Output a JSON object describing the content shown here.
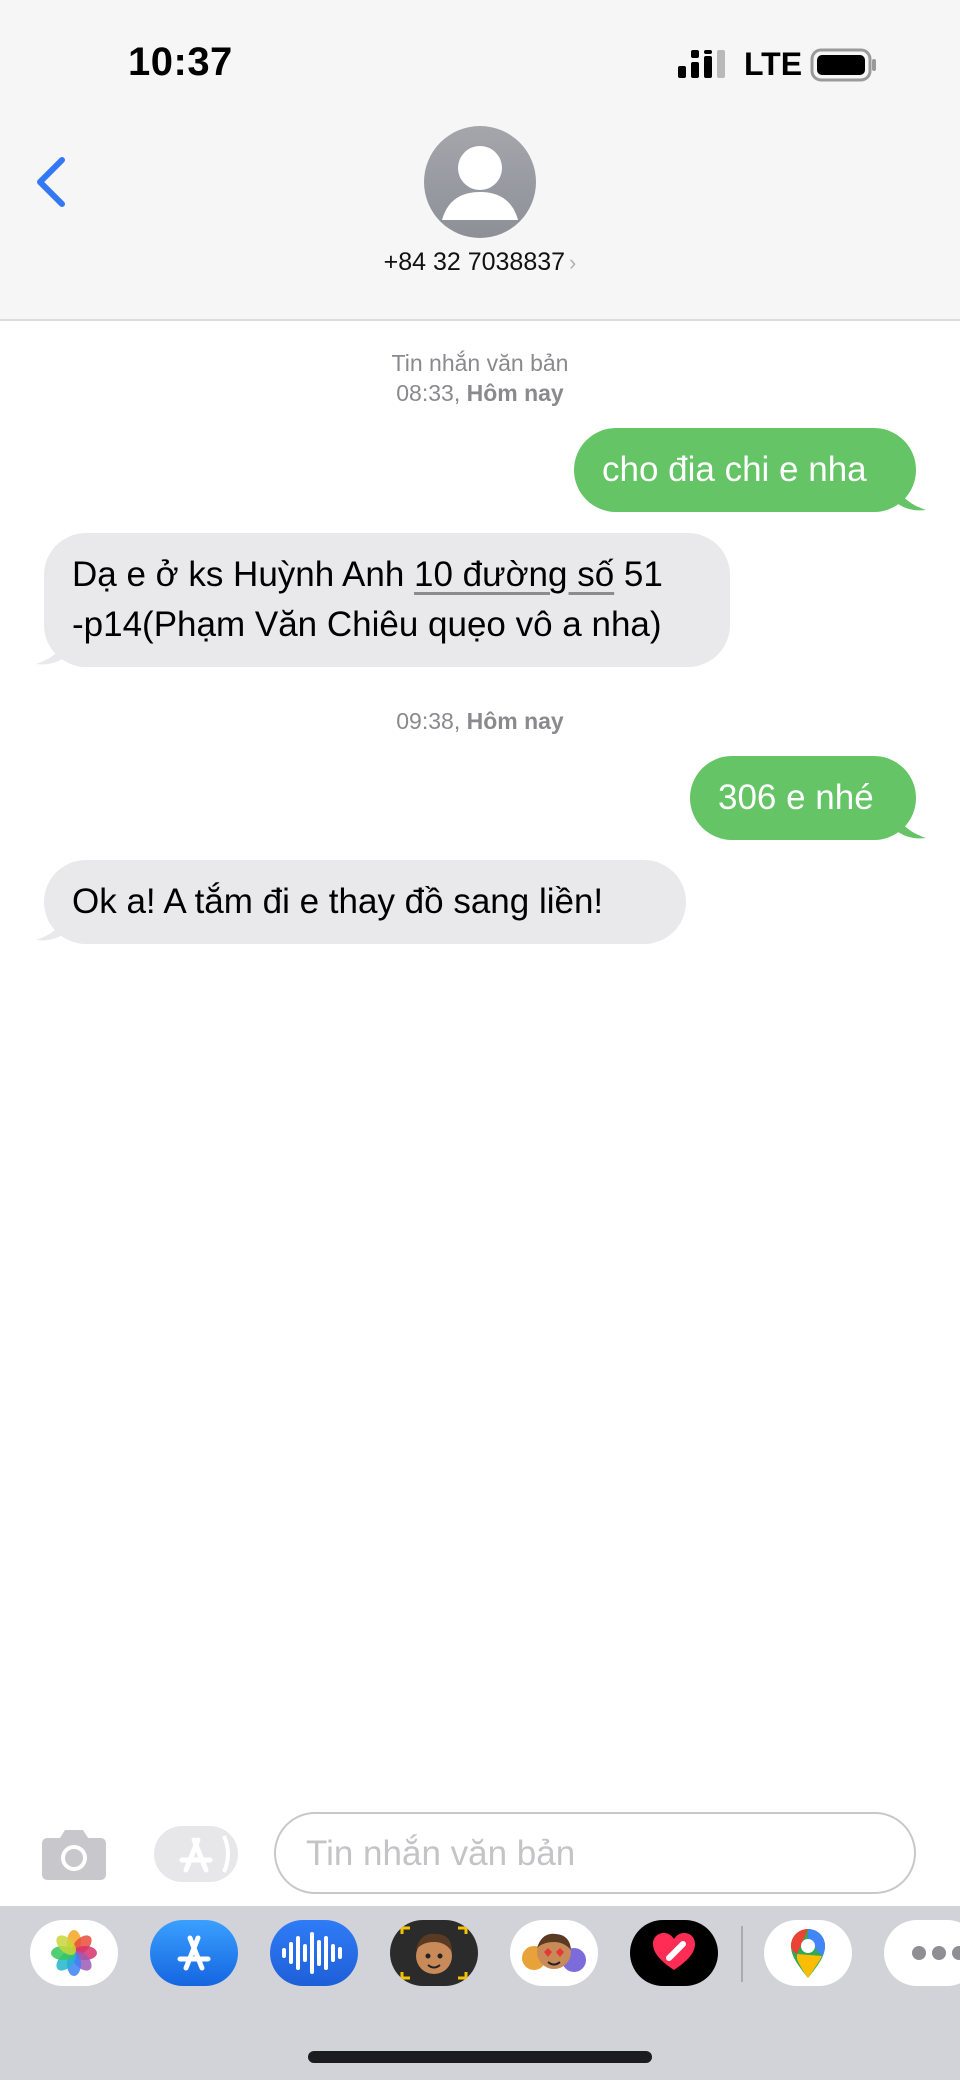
{
  "status_bar": {
    "time": "10:37",
    "network": "LTE"
  },
  "header": {
    "contact": "+84 32 7038837",
    "chevron": "›"
  },
  "conversation": {
    "stamp1": {
      "label": "Tin nhắn văn bản",
      "time": "08:33",
      "day": "Hôm nay"
    },
    "msg1": "cho đia chi e nha",
    "msg2_pre": "Dạ e ở ks Huỳnh Anh ",
    "msg2_link": "10 đường số",
    "msg2_post": " 51",
    "msg2_line2": "-p14(Phạm Văn Chiêu quẹo vô a nha)",
    "stamp2": {
      "time": "09:38",
      "day": "Hôm nay"
    },
    "msg3": "306 e nhé",
    "msg4": "Ok a! A tắm đi e thay đồ sang liền!"
  },
  "composer": {
    "placeholder": "Tin nhắn văn bản"
  },
  "drawer": {
    "apps": [
      "photos-icon",
      "app-store-icon",
      "audio-message-icon",
      "memoji-camera-icon",
      "memoji-stickers-icon",
      "digital-touch-icon",
      "maps-icon",
      "more-icon"
    ],
    "colors": {
      "out_bubble": "#65c466",
      "in_bubble": "#e9e9eb",
      "accent": "#3478f6"
    }
  }
}
